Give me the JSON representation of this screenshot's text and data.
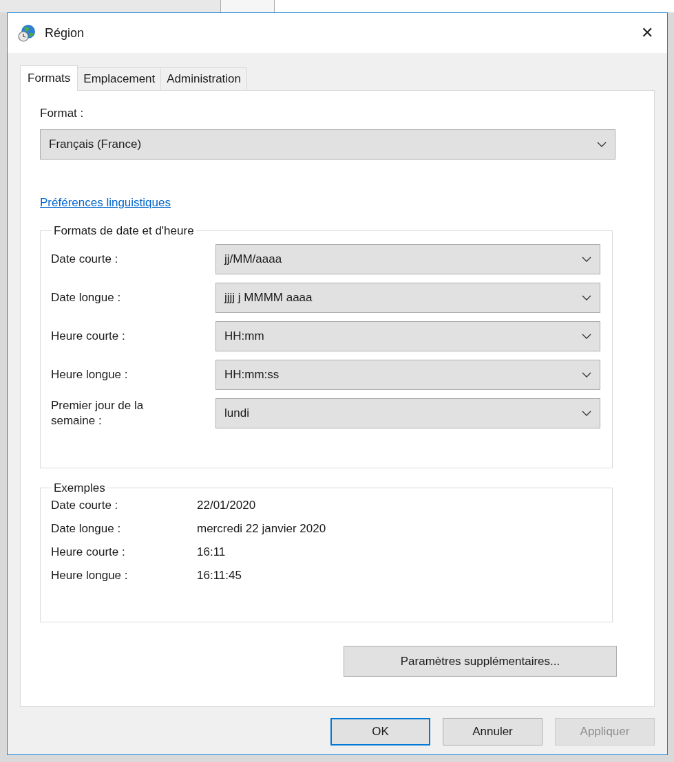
{
  "window": {
    "title": "Région",
    "close": "✕"
  },
  "tabs": [
    {
      "label": "Formats",
      "selected": true
    },
    {
      "label": "Emplacement",
      "selected": false
    },
    {
      "label": "Administration",
      "selected": false
    }
  ],
  "format": {
    "label": "Format :",
    "value": "Français (France)"
  },
  "language_link": "Préférences linguistiques",
  "date_time_formats": {
    "title": "Formats de date et d'heure",
    "rows": [
      {
        "label": "Date courte :",
        "value": "jj/MM/aaaa"
      },
      {
        "label": "Date longue :",
        "value": "jjjj j MMMM aaaa"
      },
      {
        "label": "Heure courte :",
        "value": "HH:mm"
      },
      {
        "label": "Heure longue :",
        "value": "HH:mm:ss"
      },
      {
        "label": "Premier jour de la semaine :",
        "value": "lundi"
      }
    ]
  },
  "examples": {
    "title": "Exemples",
    "rows": [
      {
        "label": "Date courte :",
        "value": "22/01/2020"
      },
      {
        "label": "Date longue :",
        "value": "mercredi 22 janvier 2020"
      },
      {
        "label": "Heure courte :",
        "value": "16:11"
      },
      {
        "label": "Heure longue :",
        "value": "16:11:45"
      }
    ]
  },
  "more_settings_button": "Paramètres supplémentaires...",
  "buttons": [
    {
      "label": "OK",
      "kind": "default",
      "disabled": false
    },
    {
      "label": "Annuler",
      "kind": "normal",
      "disabled": false
    },
    {
      "label": "Appliquer",
      "kind": "normal",
      "disabled": true
    }
  ]
}
